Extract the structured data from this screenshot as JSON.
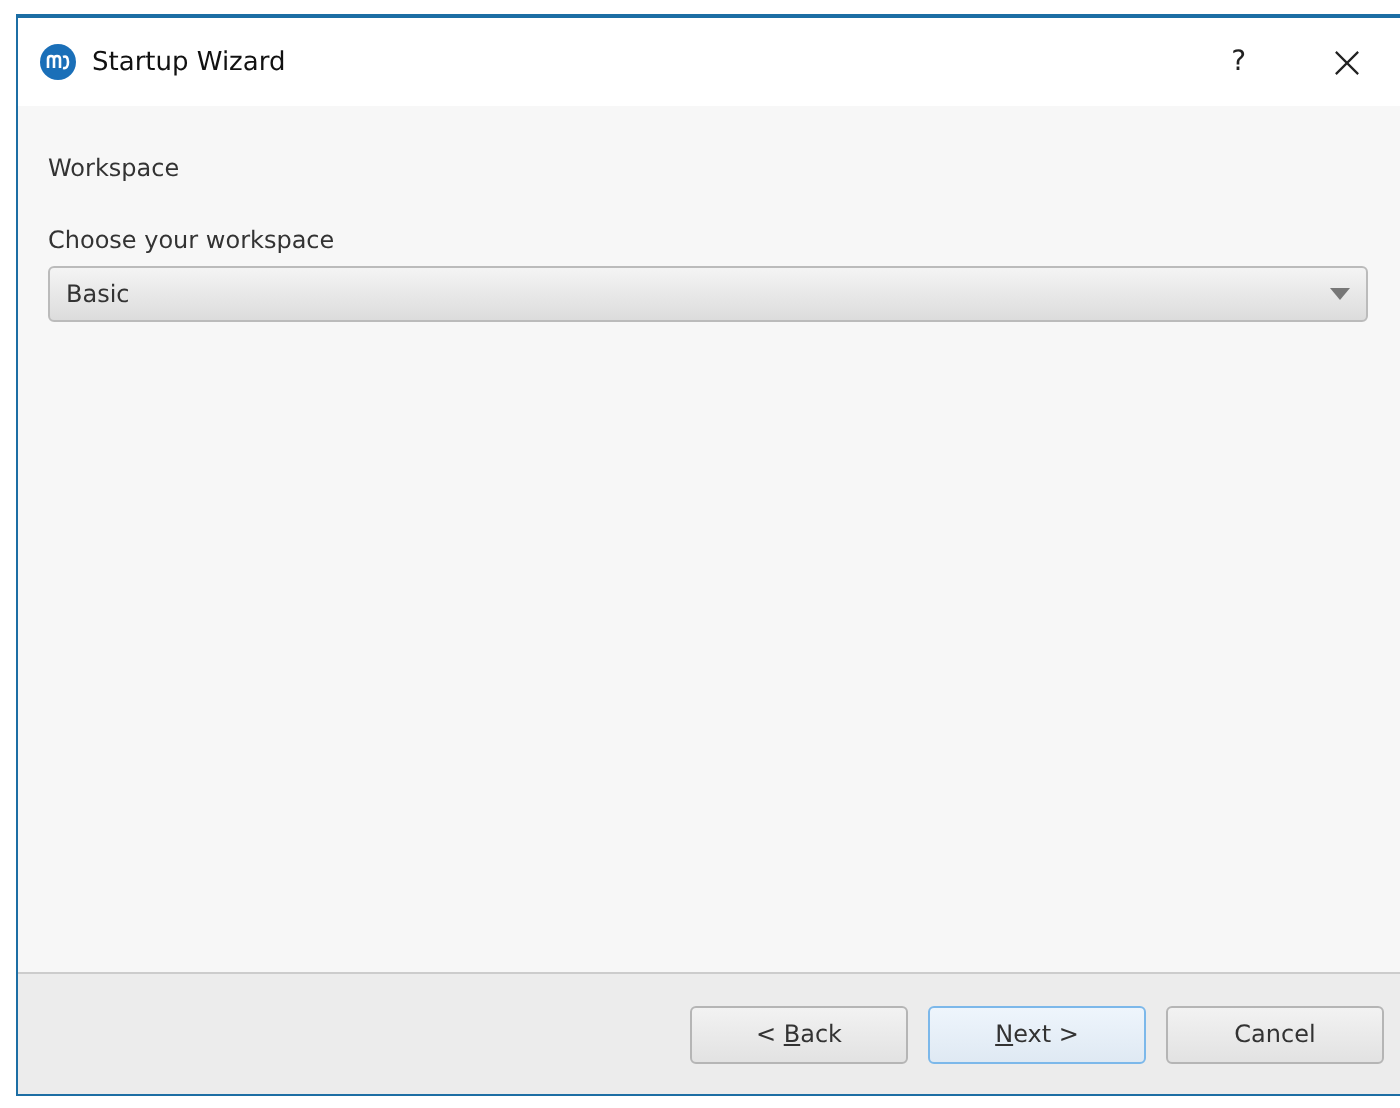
{
  "window": {
    "title": "Startup Wizard",
    "help": "?"
  },
  "page": {
    "heading": "Workspace",
    "label": "Choose your workspace",
    "combo": {
      "value": "Basic"
    }
  },
  "buttons": [
    {
      "before": "< ",
      "key": "B",
      "after": "ack",
      "focused": false
    },
    {
      "key": "N",
      "after": "ext >",
      "focused": true
    },
    {
      "before": "Cancel",
      "focused": false
    }
  ]
}
